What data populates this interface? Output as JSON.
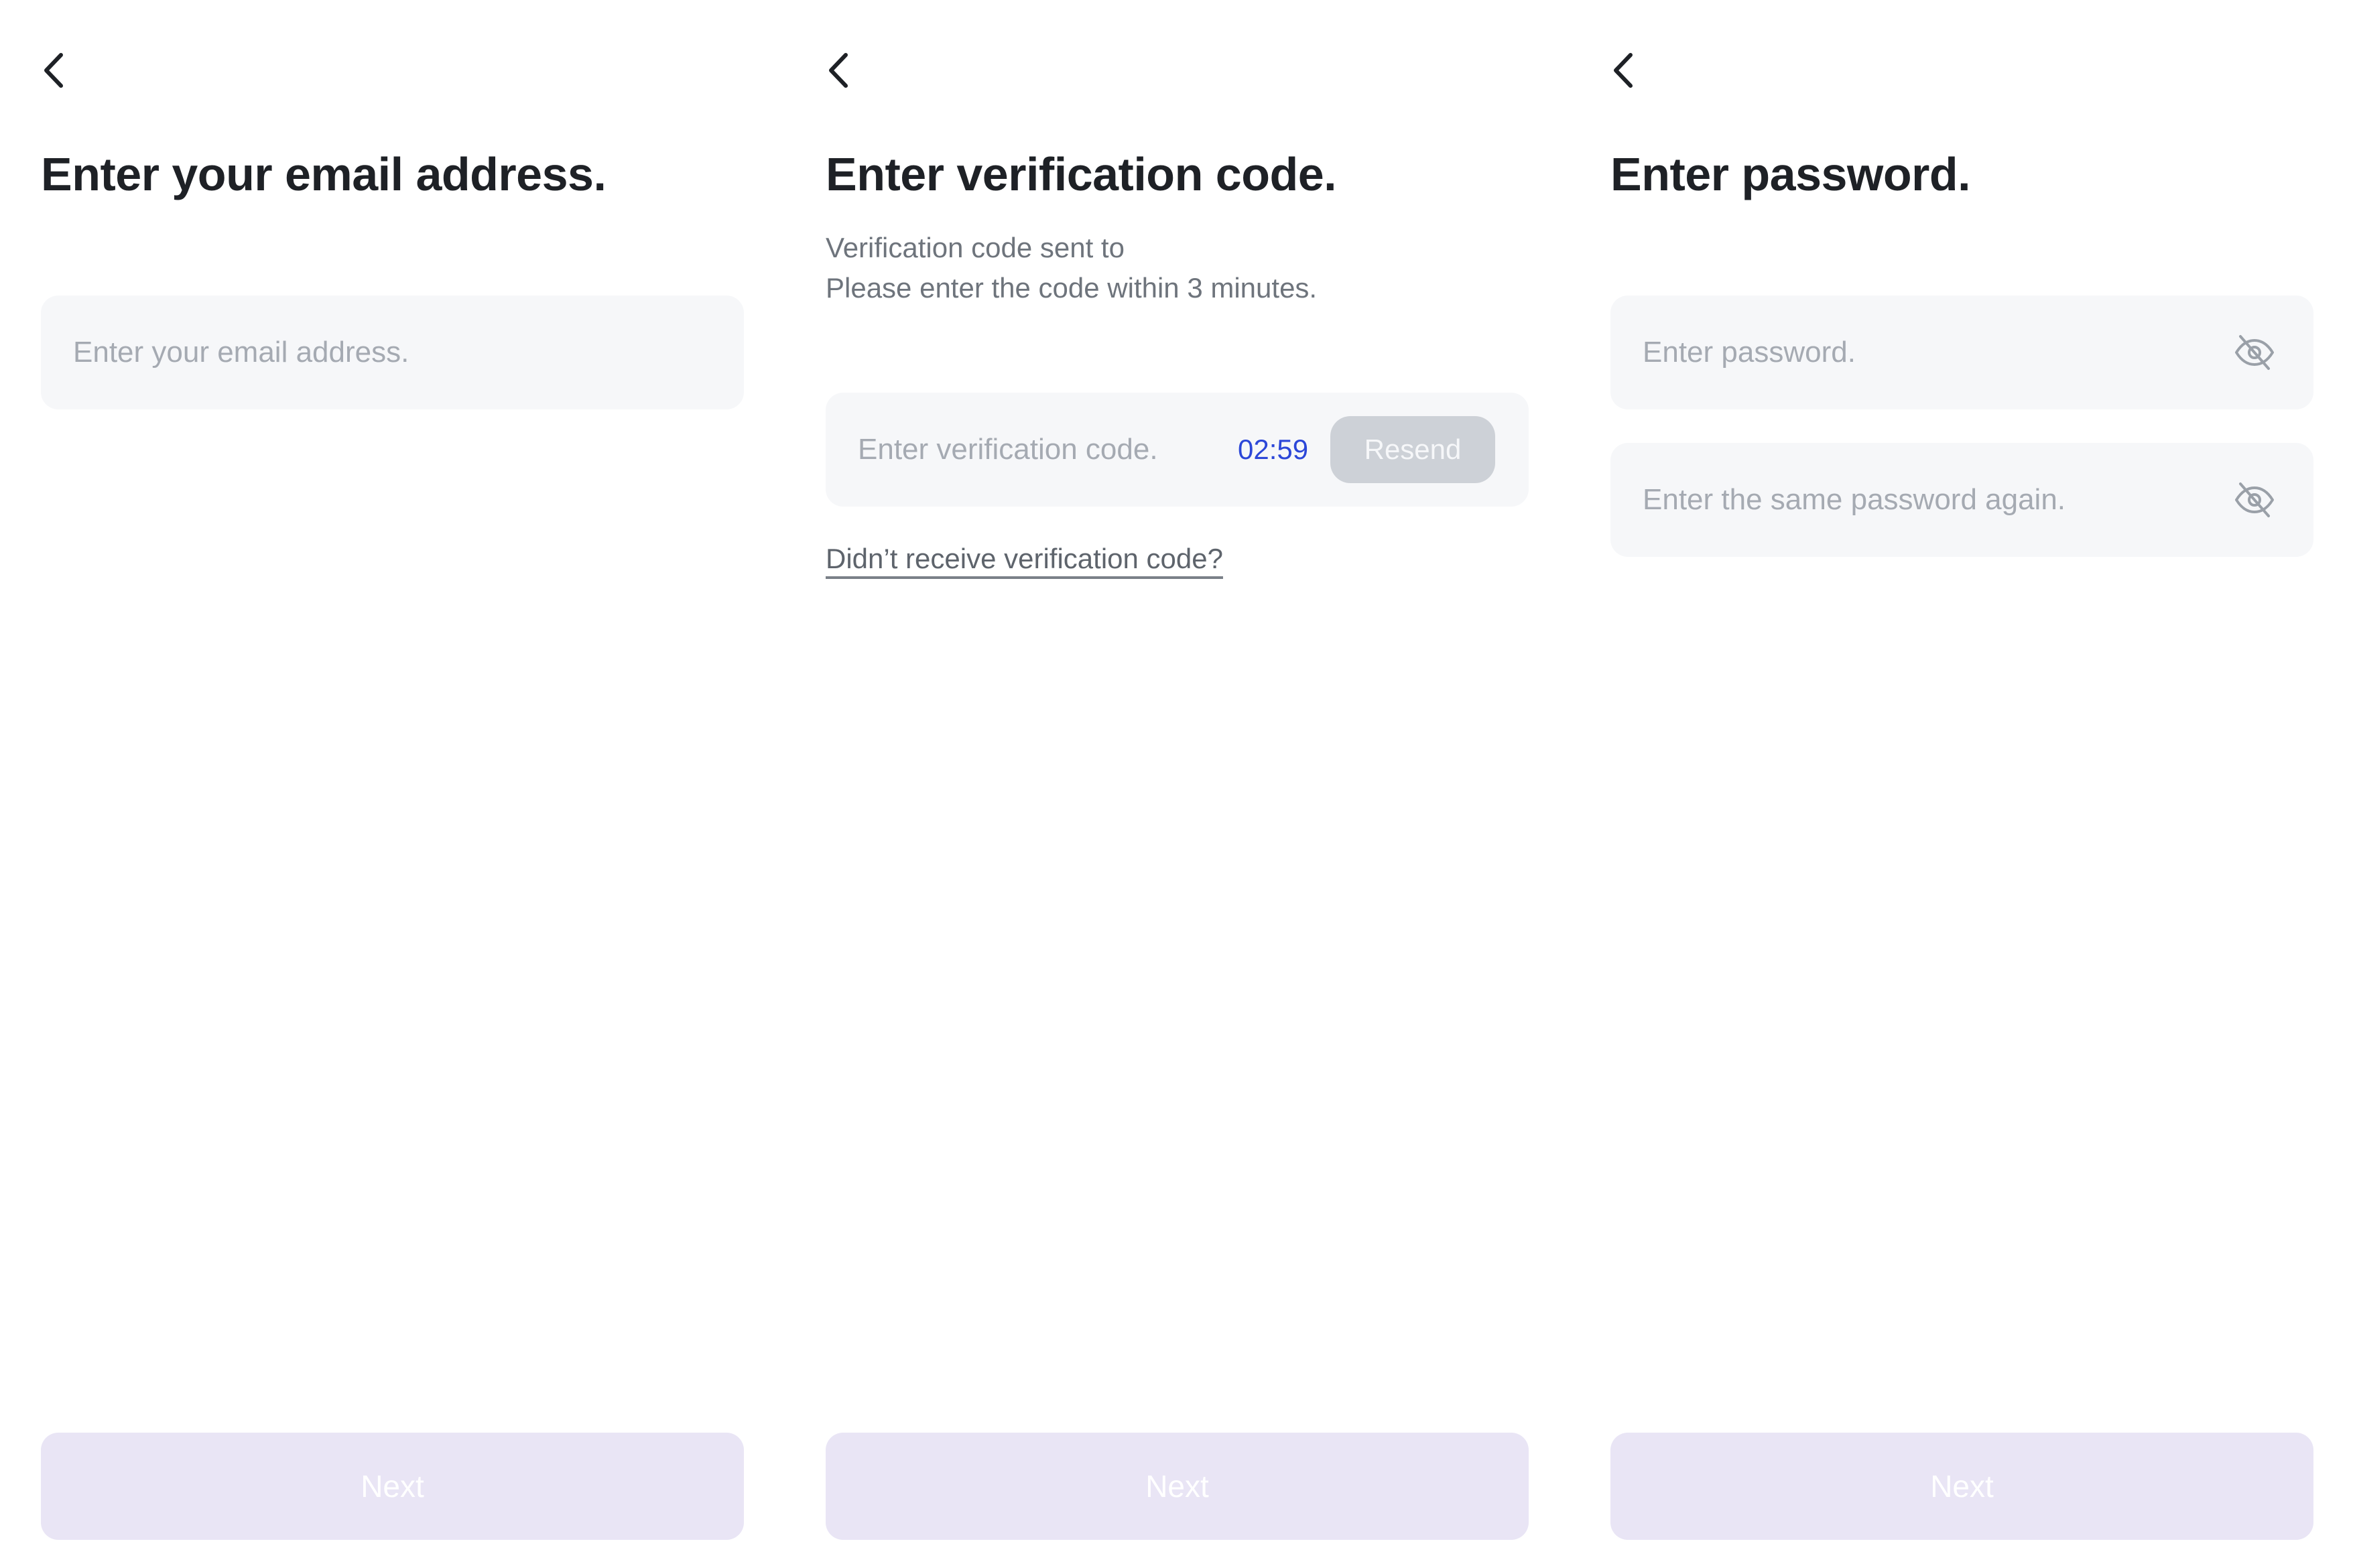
{
  "colors": {
    "background": "#ffffff",
    "title": "#1e2126",
    "secondary_text": "#6e747c",
    "placeholder": "#a5aab2",
    "field_background": "#f6f7f9",
    "timer": "#2c47d8",
    "resend_disabled_bg": "#cdd1d7",
    "next_disabled_bg": "#e9e5f5",
    "next_text": "#ffffff"
  },
  "email_screen": {
    "back_icon": "chevron-left-icon",
    "title": "Enter your email address.",
    "email_input": {
      "placeholder": "Enter your email address.",
      "value": ""
    },
    "next_label": "Next"
  },
  "verification_screen": {
    "back_icon": "chevron-left-icon",
    "title": "Enter verification code.",
    "sent_to_text": "Verification code sent to",
    "instruction_text": "Please enter the code within 3 minutes.",
    "code_input": {
      "placeholder": "Enter verification code.",
      "value": ""
    },
    "timer": "02:59",
    "resend_label": "Resend",
    "help_link": "Didn’t receive verification code?",
    "next_label": "Next"
  },
  "password_screen": {
    "back_icon": "chevron-left-icon",
    "title": "Enter password.",
    "password_input": {
      "placeholder": "Enter password.",
      "value": "",
      "toggle_icon": "eye-off-icon"
    },
    "confirm_input": {
      "placeholder": "Enter the same password again.",
      "value": "",
      "toggle_icon": "eye-off-icon"
    },
    "next_label": "Next"
  }
}
